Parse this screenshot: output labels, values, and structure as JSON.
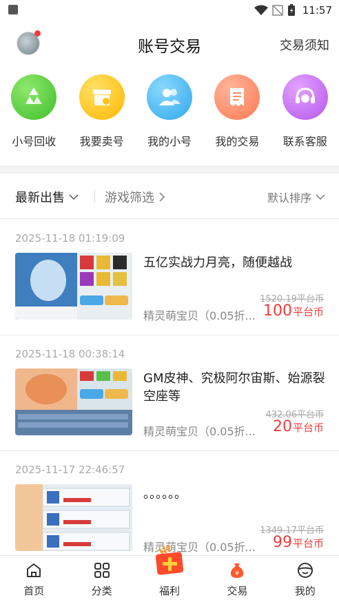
{
  "status_bar": {
    "time": "11:57"
  },
  "header": {
    "title": "账号交易",
    "notice_label": "交易须知"
  },
  "quick_menu": [
    {
      "label": "小号回收",
      "icon": "recycle-icon",
      "color": "#4fcc3a"
    },
    {
      "label": "我要卖号",
      "icon": "shop-icon",
      "color": "#ffc21a"
    },
    {
      "label": "我的小号",
      "icon": "users-icon",
      "color": "#3fb6f0"
    },
    {
      "label": "我的交易",
      "icon": "receipt-icon",
      "color": "#ff8766"
    },
    {
      "label": "联系客服",
      "icon": "headset-icon",
      "color": "#c46bf0"
    }
  ],
  "filters": {
    "latest": "最新出售",
    "game": "游戏筛选",
    "sort": "默认排序"
  },
  "listings": [
    {
      "time": "2025-11-18 01:19:09",
      "title": "五亿实战力月亮，随便越战",
      "game": "精灵萌宝贝（0.05折...",
      "original_price": "1520.19平台币",
      "price": "100",
      "unit": "平台币"
    },
    {
      "time": "2025-11-18 00:38:14",
      "title": "GM皮神、究极阿尔宙斯、始源裂空座等",
      "game": "精灵萌宝贝（0.05折...",
      "original_price": "432.06平台币",
      "price": "20",
      "unit": "平台币"
    },
    {
      "time": "2025-11-17 22:46:57",
      "title": "。。。。。。",
      "game": "精灵萌宝贝（0.05折...",
      "original_price": "1349.17平台币",
      "price": "99",
      "unit": "平台币"
    }
  ],
  "tabbar": [
    {
      "label": "首页",
      "icon": "home-icon"
    },
    {
      "label": "分类",
      "icon": "grid-icon"
    },
    {
      "label": "福利",
      "icon": "gift-icon"
    },
    {
      "label": "交易",
      "icon": "money-bag-icon"
    },
    {
      "label": "我的",
      "icon": "profile-icon"
    }
  ],
  "colors": {
    "price": "#f03b3b",
    "accent": "#ff5a2c"
  }
}
